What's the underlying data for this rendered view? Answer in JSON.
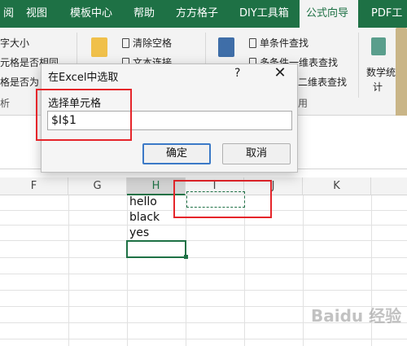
{
  "ribbon_tabs": [
    "阅",
    "视图",
    "模板中心",
    "帮助",
    "方方格子",
    "DIY工具箱",
    "公式向导",
    "PDF工"
  ],
  "active_tab_index": 6,
  "ribbon": {
    "items_left": [
      "字大小",
      "元格是否相同",
      "格是否为"
    ],
    "group_left": "析",
    "items_mid": [
      "清除空格",
      "文本连接"
    ],
    "items_right": [
      "单条件查找",
      "多条件一维表查找",
      "二维表查找"
    ],
    "group_right": "用",
    "stats_label_1": "数学统",
    "stats_label_2": "计"
  },
  "columns": [
    "F",
    "G",
    "H",
    "I",
    "J",
    "K"
  ],
  "selected_column": "H",
  "cells": {
    "h1": "hello",
    "h2": "black",
    "h3": "yes"
  },
  "dialog": {
    "title": "在Excel中选取",
    "help": "?",
    "close": "✕",
    "label": "选择单元格",
    "input_value": "$I$1",
    "ok_label": "确定",
    "cancel_label": "取消"
  },
  "colors": {
    "excel_green": "#1e7145",
    "highlight_red": "#e5252a",
    "default_button_blue": "#3b79c7"
  },
  "watermark": "Baidu 经验"
}
